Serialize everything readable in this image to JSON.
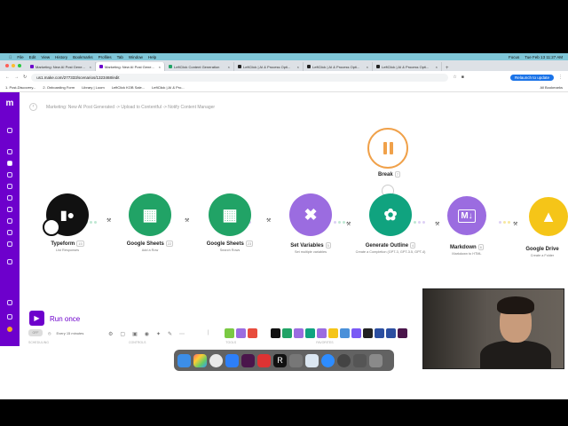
{
  "menubar": {
    "app": "Google Chrome",
    "items": [
      "File",
      "Edit",
      "View",
      "History",
      "Bookmarks",
      "Profiles",
      "Tab",
      "Window",
      "Help"
    ],
    "right": [
      "Focus",
      "Tue Feb 13  11:27 AM"
    ]
  },
  "tabs": [
    {
      "label": "Marketing: New AI Post Gene...",
      "active": false
    },
    {
      "label": "Marketing: New AI Post Gene...",
      "active": true
    },
    {
      "label": "LeftClick Content Generation",
      "active": false
    },
    {
      "label": "LeftClick | AI & Process Opti...",
      "active": false
    },
    {
      "label": "LeftClick | AI & Process Opti...",
      "active": false
    },
    {
      "label": "LeftClick | AI & Process Opti...",
      "active": false
    }
  ],
  "address": {
    "url": "us1.make.com/277333/scenarios/1323468/edit",
    "relaunch": "Relaunch to update"
  },
  "bookmarks": {
    "items": [
      "1. Post-Discovery...",
      "2. Onboarding Form",
      "Library | Loom",
      "LeftClick KOB Sale...",
      "LeftClick | AI & Pro..."
    ],
    "all": "All Bookmarks"
  },
  "app": {
    "breadcrumb": "Marketing: New AI Post Generated -> Upload to Contentful -> Notify Content Manager",
    "nodes": [
      {
        "name": "Typeform",
        "badge": "15",
        "sub": "List Responses",
        "color": "#111111",
        "icon": "typeform-icon"
      },
      {
        "name": "Google Sheets",
        "badge": "22",
        "sub": "Add a Row",
        "color": "#21a366",
        "icon": "sheets-icon"
      },
      {
        "name": "Google Sheets",
        "badge": "23",
        "sub": "Search Rows",
        "color": "#21a366",
        "icon": "sheets-icon"
      },
      {
        "name": "Set Variables",
        "badge": "5",
        "sub": "Set multiple variables",
        "color": "#9b6ce0",
        "icon": "tools-icon"
      },
      {
        "name": "Generate Outline",
        "badge": "4",
        "sub": "Create a Completion (GPT-3, GPT-3.5, GPT-4)",
        "color": "#10a37f",
        "icon": "openai-icon"
      },
      {
        "name": "Markdown",
        "badge": "6",
        "sub": "Markdown to HTML",
        "color": "#9b6ce0",
        "icon": "markdown-icon"
      },
      {
        "name": "Google Drive",
        "badge": "",
        "sub": "Create a Folder",
        "color": "#f5c518",
        "icon": "drive-icon"
      }
    ],
    "break_label": "Break",
    "break_badge": "7",
    "run_label": "Run once",
    "schedule_toggle": "OFF",
    "schedule_text": "Every 15 minutes",
    "footer_labels": [
      "SCHEDULING",
      "CONTROLS",
      "TOOLS",
      "FAVORITES"
    ]
  }
}
